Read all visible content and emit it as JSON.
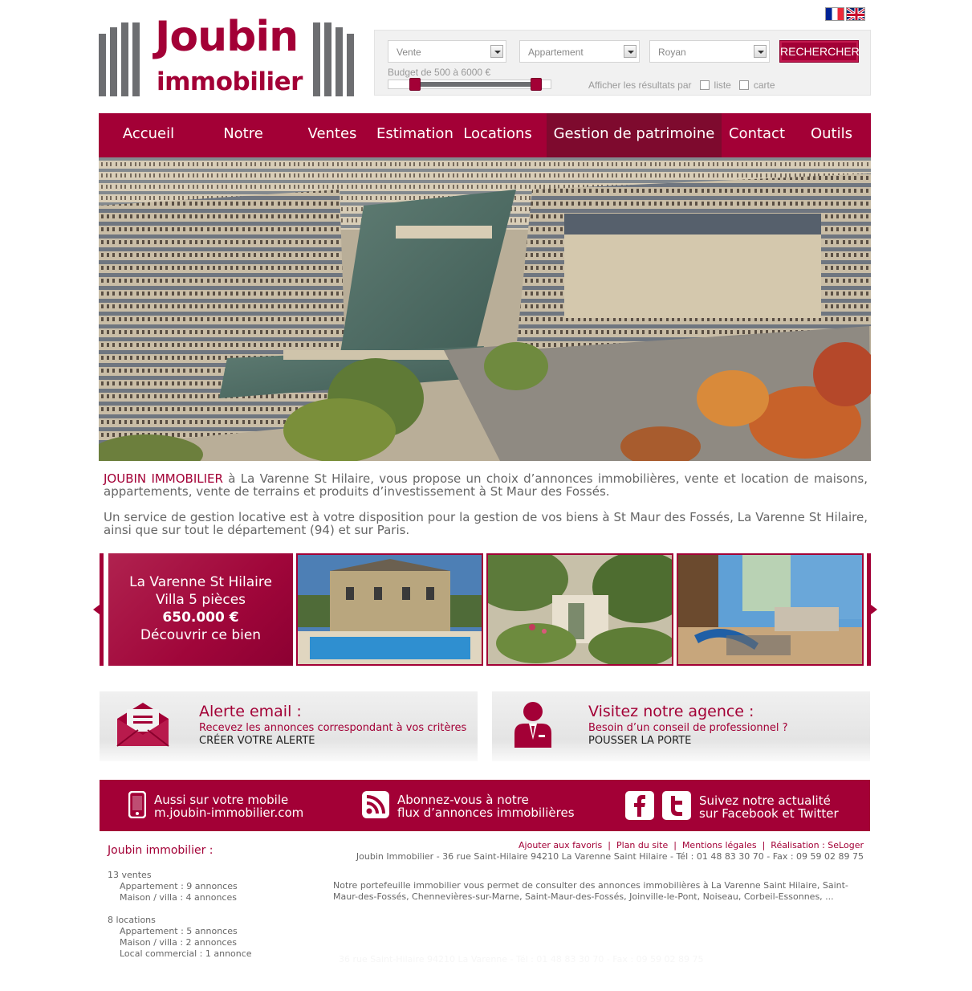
{
  "flags": [
    "flag-fr-icon",
    "flag-uk-icon"
  ],
  "logo": {
    "line1": "Joubin",
    "line2": "immobilier"
  },
  "search": {
    "transaction": "Vente",
    "property_type": "Appartement",
    "city": "Royan",
    "submit": "RECHERCHER",
    "budget_label": "Budget de 500 à 6000 €",
    "budget_min": 500,
    "budget_max": 6000,
    "display_label": "Afficher les résultats par",
    "display_list": "liste",
    "display_map": "carte"
  },
  "nav": {
    "items": [
      {
        "label": "Accueil"
      },
      {
        "label": "Notre agence"
      },
      {
        "label": "Ventes"
      },
      {
        "label": "Estimation"
      },
      {
        "label": "Locations"
      },
      {
        "label": "Gestion de patrimoine"
      },
      {
        "label": "Contact"
      },
      {
        "label": "Outils"
      }
    ],
    "active_index": 5
  },
  "intro": {
    "brand": "JOUBIN IMMOBILIER",
    "p1_rest": " à La Varenne St Hilaire, vous propose un choix d’annonces immobilières, vente et location de maisons, appartements, vente de terrains et produits d’investissement à St Maur des Fossés.",
    "p2": "Un service de gestion locative est à votre disposition pour la gestion de vos biens à St Maur des Fossés, La Varenne St Hilaire, ainsi que sur tout le département (94) et sur Paris."
  },
  "carousel": {
    "promo": {
      "line1": "La Varenne St Hilaire",
      "line2": "Villa 5 pièces",
      "price": "650.000 €",
      "cta": "Découvrir ce bien"
    }
  },
  "alert": {
    "title": "Alerte email :",
    "subtitle": "Recevez les annonces correspondant à vos critères",
    "cta": "CRÉER VOTRE ALERTE"
  },
  "visit": {
    "title": "Visitez notre agence :",
    "subtitle": "Besoin d’un conseil de professionnel ?",
    "cta": "POUSSER LA PORTE"
  },
  "band": {
    "mobile_line1": "Aussi sur votre mobile",
    "mobile_line2": "m.joubin-immobilier.com",
    "rss_line1": "Abonnez-vous à notre",
    "rss_line2": "flux d’annonces immobilières",
    "social_line1": "Suivez notre actualité",
    "social_line2": "sur Facebook et Twitter"
  },
  "footer": {
    "company_title": "Joubin immobilier :",
    "sales_count": "13  ventes",
    "sales_apartments": "Appartement : 9 annonces",
    "sales_houses": "Maison / villa : 4 annonces",
    "rentals_count": "8  locations",
    "rentals_apartments": "Appartement : 5 annonces",
    "rentals_houses": "Maison / villa : 2 annonces",
    "rentals_commercial": "Local commercial : 1 annonce",
    "links": [
      "Ajouter aux favoris",
      "Plan du site",
      "Mentions légales",
      "Réalisation : SeLoger"
    ],
    "address": "Joubin Immobilier - 36 rue Saint-Hilaire 94210 La Varenne Saint Hilaire  -  Tél : 01 48 83 30 70  -  Fax : 09 59 02 89 75",
    "portfolio": "Notre portefeuille immobilier vous permet de consulter des annonces immobilières à La Varenne Saint Hilaire, Saint-Maur-des-Fossés, Chennevières-sur-Marne, Saint-Maur-des-Fossés, Joinville-le-Pont, Noiseau, Corbeil-Essonnes, ...",
    "faded": "36 rue Saint-Hilaire 94210 La Varenne  -  Tél : 01 48 83 30 70  -  Fax : 09 59 02 89 75"
  },
  "colors": {
    "brand": "#a30036",
    "brand_dark": "#7e0a2e",
    "logo_grey": "#6d6e71"
  }
}
